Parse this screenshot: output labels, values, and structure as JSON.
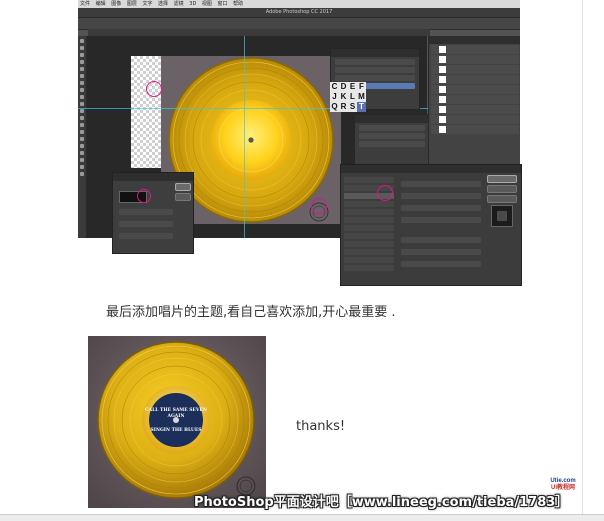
{
  "screenshot": {
    "mac_menu": [
      "文件",
      "编辑",
      "图像",
      "图层",
      "文字",
      "选择",
      "滤镜",
      "3D",
      "视图",
      "窗口",
      "帮助"
    ],
    "window_title": "Adobe Photoshop CC 2017",
    "letters": [
      "C",
      "D",
      "E",
      "F",
      "J",
      "K",
      "L",
      "M",
      "Q",
      "R",
      "S",
      "T"
    ],
    "highlight_letter": "T"
  },
  "article": {
    "caption": "最后添加唱片的主题,看自己喜欢添加,开心最重要 .",
    "thanks": "thanks!"
  },
  "result_image": {
    "label_top": "CALL THE SAME SEVEN AGAIN",
    "label_bottom": "SINGIN THE BLUES"
  },
  "watermark": {
    "text": "PhotoShop平面设计吧［www.lineeg.com/tieba/1783］"
  },
  "corner_logo": {
    "line1": "Utie.com",
    "line2": "UI教程网"
  },
  "colors": {
    "gold_light": "#ffe24a",
    "gold_mid": "#e3b514",
    "gold_dark": "#a87a08",
    "mark_ring": "#e0148c",
    "guide": "#3fc3e6"
  }
}
